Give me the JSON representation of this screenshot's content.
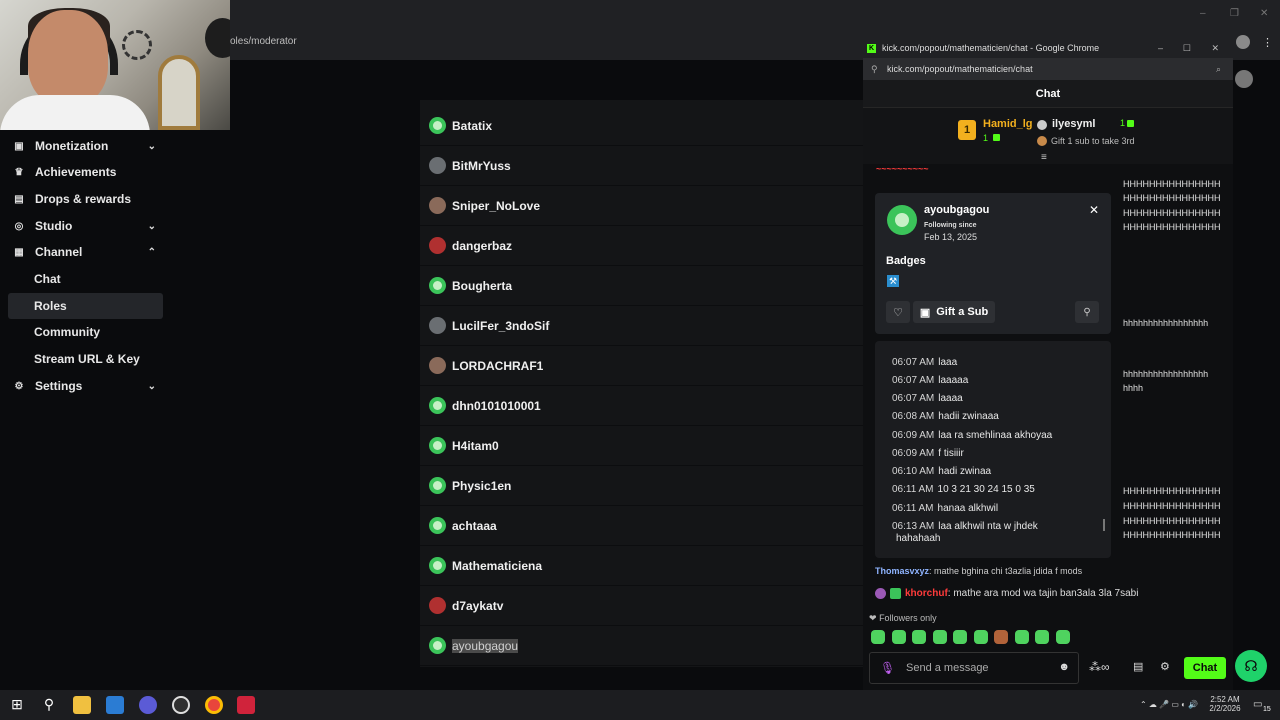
{
  "main_browser": {
    "url_fragment": "oles/moderator",
    "window_controls": [
      "–",
      "❐",
      "✕"
    ]
  },
  "sidebar": {
    "items": [
      {
        "label": "Monetization",
        "icon": "monetization-icon",
        "chevron": "⌄"
      },
      {
        "label": "Achievements",
        "icon": "trophy-icon"
      },
      {
        "label": "Drops & rewards",
        "icon": "gift-icon"
      },
      {
        "label": "Studio",
        "icon": "studio-icon",
        "chevron": "⌄"
      },
      {
        "label": "Channel",
        "icon": "channel-icon",
        "chevron": "⌃"
      }
    ],
    "channel_sub": [
      {
        "label": "Chat"
      },
      {
        "label": "Roles",
        "active": true
      },
      {
        "label": "Community"
      },
      {
        "label": "Stream URL & Key"
      }
    ],
    "settings": {
      "label": "Settings",
      "icon": "gear-icon",
      "chevron": "⌄"
    }
  },
  "user_list": [
    {
      "name": "Batatix",
      "avatar": "g"
    },
    {
      "name": "BitMrYuss",
      "avatar": "d"
    },
    {
      "name": "Sniper_NoLove",
      "avatar": "p"
    },
    {
      "name": "dangerbaz",
      "avatar": "r"
    },
    {
      "name": "Bougherta",
      "avatar": "g"
    },
    {
      "name": "LucilFer_3ndoSif",
      "avatar": "d"
    },
    {
      "name": "LORDACHRAF1",
      "avatar": "p"
    },
    {
      "name": "dhn0101010001",
      "avatar": "g"
    },
    {
      "name": "H4itam0",
      "avatar": "g"
    },
    {
      "name": "Physic1en",
      "avatar": "g"
    },
    {
      "name": "achtaaa",
      "avatar": "g"
    },
    {
      "name": "Mathematiciena",
      "avatar": "g"
    },
    {
      "name": "d7aykatv",
      "avatar": "r"
    },
    {
      "name": "ayoubgagou",
      "avatar": "g",
      "highlight": true
    }
  ],
  "popout": {
    "window_title": "kick.com/popout/mathematicien/chat - Google Chrome",
    "url": "kick.com/popout/mathematicien/chat",
    "header": "Chat",
    "leaderboard": {
      "first": {
        "rank": "1",
        "name": "Hamid_lg",
        "count": "1"
      },
      "second": {
        "name": "ilyesyml",
        "count": "1"
      },
      "third_hint": "Gift 1 sub to take 3rd"
    },
    "chat_lines": [
      "HHHHHHHHHHHHHHH",
      "HHHHHHHHHHHHHHH",
      "HHHHHHHHHHHHHHH",
      "HHHHHHHHHHHHHHH",
      "hhhhhhhhhhhhhhhhh",
      "hhhhhhhhhhhhhhhhh",
      "hhhh",
      "HHHHHHHHHHHHHHH",
      "HHHHHHHHHHHHHHH",
      "HHHHHHHHHHHHHHH",
      "HHHHHHHHHHHHHHH"
    ],
    "user_card": {
      "username": "ayoubgagou",
      "following_since_label": "Following since",
      "following_since_date": "Feb 13, 2025",
      "badges_label": "Badges",
      "gift_sub_label": "Gift a Sub"
    },
    "messages": [
      {
        "ts": "06:07 AM",
        "text": "laaa"
      },
      {
        "ts": "06:07 AM",
        "text": "laaaaa"
      },
      {
        "ts": "06:07 AM",
        "text": "laaaa"
      },
      {
        "ts": "06:08 AM",
        "text": "hadii zwinaaa"
      },
      {
        "ts": "06:09 AM",
        "text": "laa ra smehlinaa akhoyaa"
      },
      {
        "ts": "06:09 AM",
        "text": "f tisiiir"
      },
      {
        "ts": "06:10 AM",
        "text": "hadi zwinaa"
      },
      {
        "ts": "06:11 AM",
        "text": "10 3 21 30 24 15 0 35"
      },
      {
        "ts": "06:11 AM",
        "text": "hanaa alkhwil"
      },
      {
        "ts": "06:13 AM",
        "text": "laa alkhwil nta w jhdek"
      },
      {
        "ts": "",
        "text": "hahahaah"
      }
    ],
    "bottom_chat": [
      {
        "user": "Thomasvxyz",
        "text": ": mathe bghina chi t3azlia jdida f mods",
        "color": "#8fb4ff"
      },
      {
        "user": "khorchuf",
        "text": ": mathe ara mod wa tajin ban3ala 3la 7sabi",
        "color": "#ff3b3b"
      }
    ],
    "followers_only": "Followers only",
    "input_placeholder": "Send a message",
    "chat_button": "Chat"
  },
  "taskbar": {
    "time": "2:52 AM",
    "date": "2/2/2026",
    "notif_count": "15"
  }
}
